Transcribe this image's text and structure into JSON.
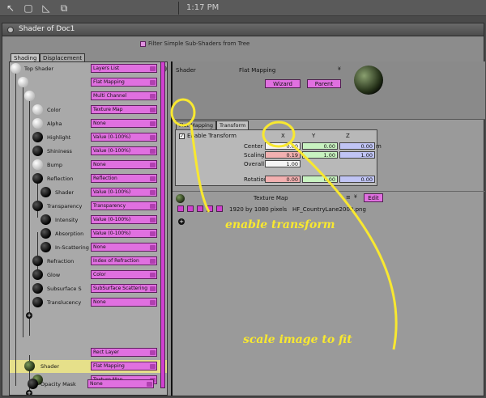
{
  "appbar": {
    "clock": "1:17 PM",
    "tools": [
      "select-icon",
      "frame-icon",
      "skew-icon",
      "scale-icon"
    ]
  },
  "window": {
    "title": "Shader of Doc1",
    "filter_label": "Filter Simple Sub-Shaders from Tree"
  },
  "left_tabs": {
    "shading": "Shading",
    "displacement": "Displacement"
  },
  "tree": {
    "rows": [
      {
        "label": "Top Shader",
        "value": "Layers List"
      },
      {
        "label": "",
        "value": "Flat Mapping"
      },
      {
        "label": "",
        "value": "Multi Channel"
      },
      {
        "label": "Color",
        "value": "Texture Map"
      },
      {
        "label": "Alpha",
        "value": "None"
      },
      {
        "label": "Highlight",
        "value": "Value (0-100%)"
      },
      {
        "label": "Shininess",
        "value": "Value (0-100%)"
      },
      {
        "label": "Bump",
        "value": "None"
      },
      {
        "label": "Reflection",
        "value": "Reflection"
      },
      {
        "label": "Shader",
        "value": "Value (0-100%)"
      },
      {
        "label": "Transparency",
        "value": "Transparency"
      },
      {
        "label": "Intensity",
        "value": "Value (0-100%)"
      },
      {
        "label": "Absorption",
        "value": "Value (0-100%)"
      },
      {
        "label": "In-Scattering",
        "value": "None"
      },
      {
        "label": "Refraction",
        "value": "Index of Refraction"
      },
      {
        "label": "Glow",
        "value": "Color"
      },
      {
        "label": "Subsurface S",
        "value": "SubSurface Scattering"
      },
      {
        "label": "Translucency",
        "value": "None"
      },
      {
        "label": "",
        "value": "Rect Layer"
      },
      {
        "label": "Shader",
        "value": "Flat Mapping"
      },
      {
        "label": "",
        "value": "Texture Map"
      },
      {
        "label": "Opacity Mask",
        "value": "None"
      }
    ]
  },
  "right": {
    "shader_label": "Shader",
    "mapping_label": "Flat Mapping",
    "wizard": "Wizard",
    "parent": "Parent",
    "tabs": [
      "Flat Mapping",
      "Transform"
    ],
    "enable_label": "Enable Transform",
    "cols": [
      "X",
      "Y",
      "Z"
    ],
    "center_label": "Center",
    "center": [
      "0.00",
      "0.00",
      "0.00"
    ],
    "center_unit": "m",
    "scaling_label": "Scaling",
    "scaling": [
      "0.19",
      "1.00",
      "1.00"
    ],
    "overall_label": "Overall",
    "overall": "1.00",
    "rotation_label": "Rotation",
    "rotation": [
      "0.00",
      "0.00",
      "0.00"
    ],
    "texture_label": "Texture Map",
    "edit": "Edit",
    "resolution": "1920 by 1080 pixels",
    "filename": "HF_CountryLane2000.png"
  },
  "annotations": {
    "enable": "enable transform",
    "scale": "scale image to fit"
  },
  "colors": {
    "accent": "#e070e0",
    "annotation": "#f8e830"
  }
}
